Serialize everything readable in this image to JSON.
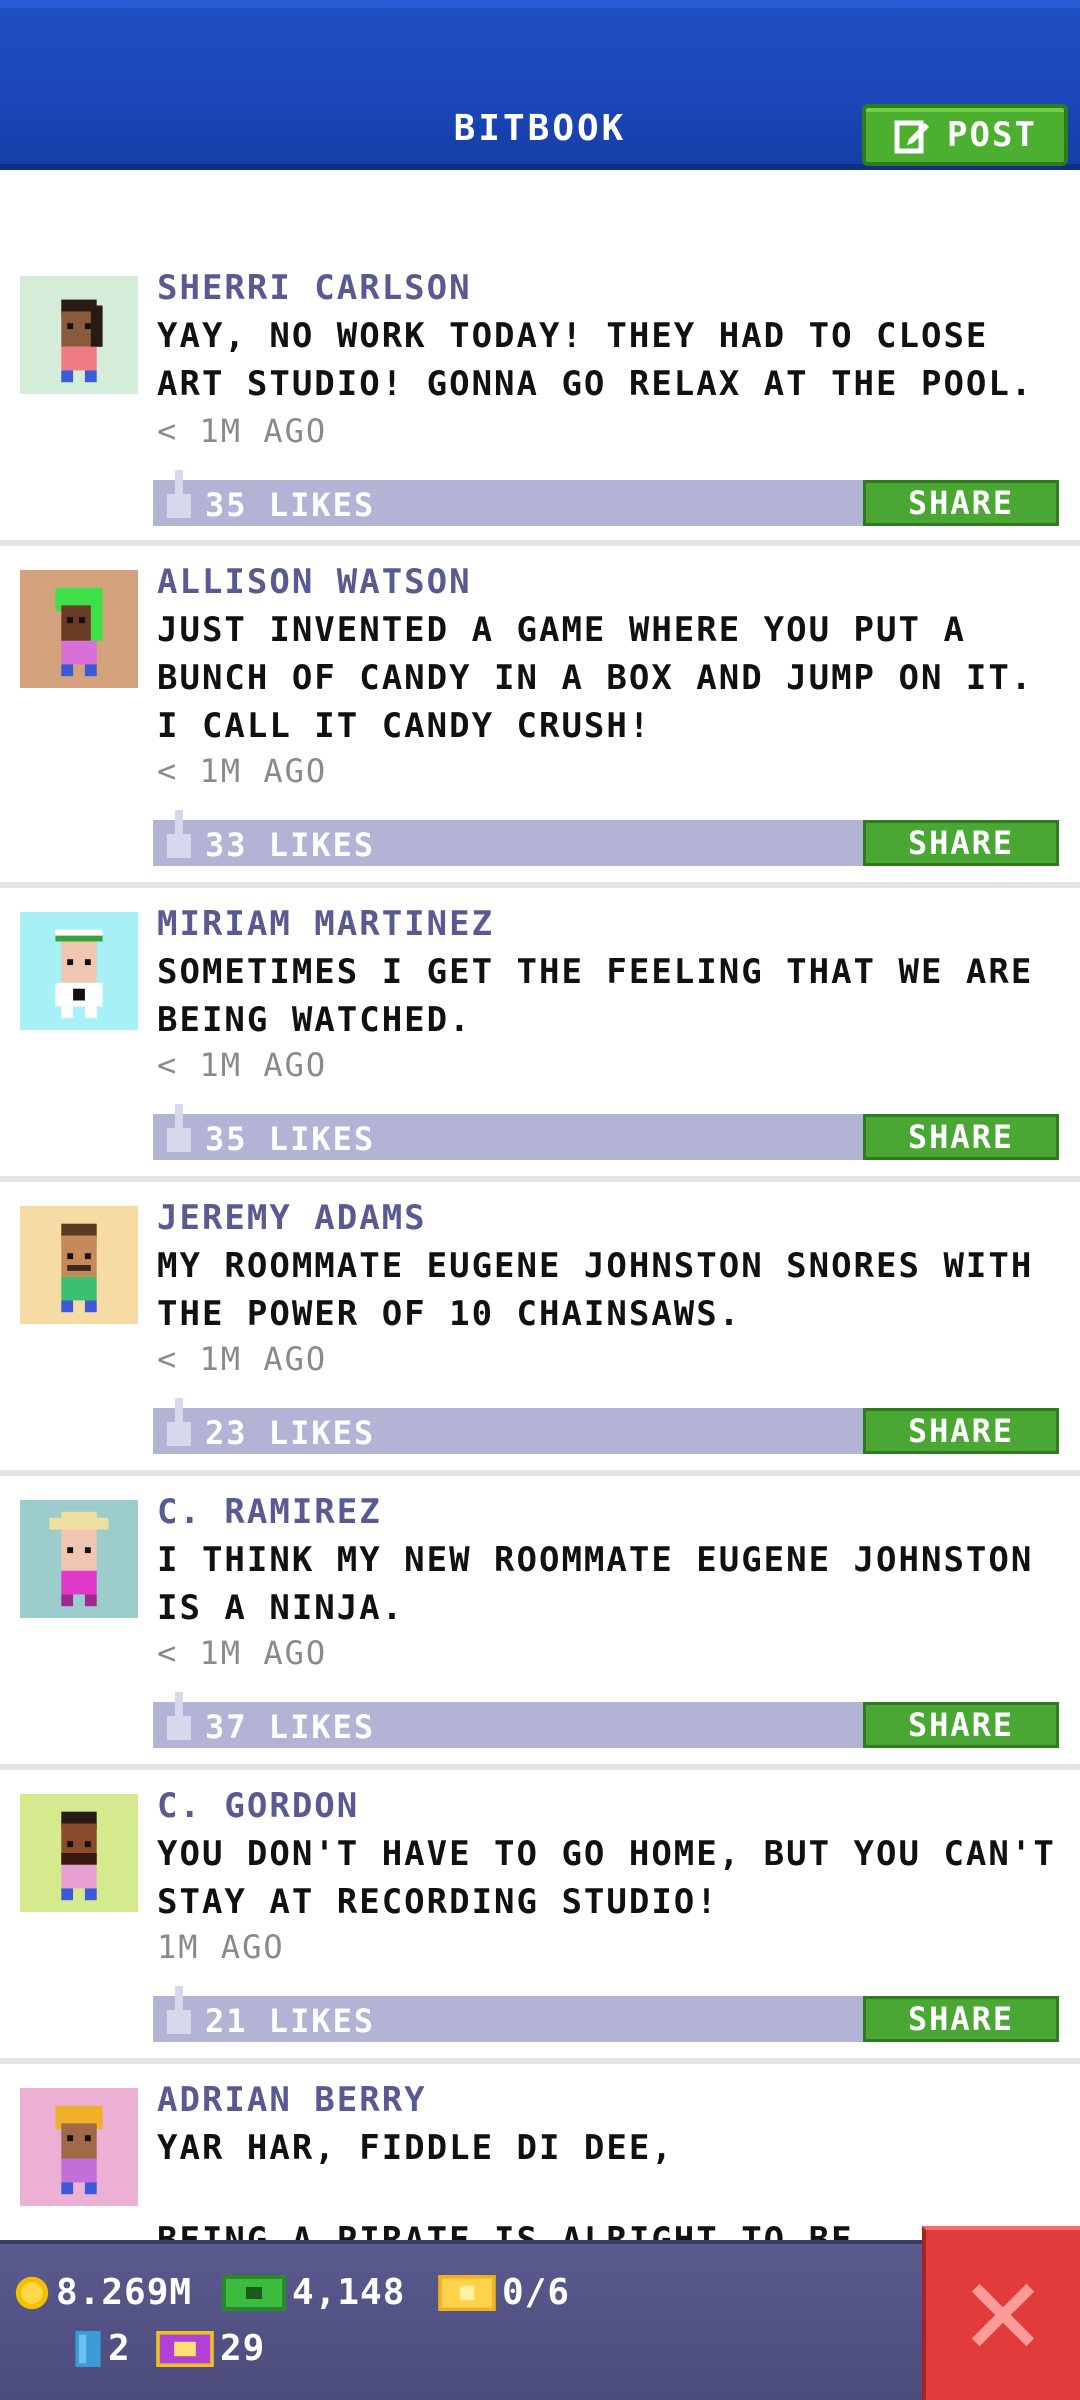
{
  "header": {
    "title": "BITBOOK",
    "post_label": "POST"
  },
  "posts": [
    {
      "name": "SHERRI CARLSON",
      "text": "YAY, NO WORK TODAY! THEY HAD TO CLOSE ART STUDIO! GONNA GO RELAX AT THE POOL.",
      "time": "< 1M AGO",
      "likes": "35 LIKES",
      "share": "SHARE",
      "avatar_bg": "#d4ecd8"
    },
    {
      "name": "ALLISON WATSON",
      "text": "JUST INVENTED A GAME WHERE YOU PUT A BUNCH OF CANDY IN A BOX AND JUMP ON IT. I CALL IT CANDY CRUSH!",
      "time": "< 1M AGO",
      "likes": "33 LIKES",
      "share": "SHARE",
      "avatar_bg": "#d4a27c"
    },
    {
      "name": "MIRIAM MARTINEZ",
      "text": "SOMETIMES I GET THE FEELING THAT WE ARE BEING WATCHED.",
      "time": "< 1M AGO",
      "likes": "35 LIKES",
      "share": "SHARE",
      "avatar_bg": "#a6f0f6"
    },
    {
      "name": "JEREMY ADAMS",
      "text": "MY ROOMMATE EUGENE JOHNSTON SNORES WITH THE POWER OF 10 CHAINSAWS.",
      "time": "< 1M AGO",
      "likes": "23 LIKES",
      "share": "SHARE",
      "avatar_bg": "#f6dca4"
    },
    {
      "name": "C. RAMIREZ",
      "text": "I THINK MY NEW ROOMMATE EUGENE JOHNSTON IS A NINJA.",
      "time": "< 1M AGO",
      "likes": "37 LIKES",
      "share": "SHARE",
      "avatar_bg": "#9ccccc"
    },
    {
      "name": "C. GORDON",
      "text": "YOU DON'T HAVE TO GO HOME, BUT YOU CAN'T STAY AT RECORDING STUDIO!",
      "time": "1M AGO",
      "likes": "21 LIKES",
      "share": "SHARE",
      "avatar_bg": "#d4ea8c"
    },
    {
      "name": "ADRIAN BERRY",
      "text": "YAR HAR, FIDDLE DI DEE,",
      "text2": "BEING A PIRATE IS ALRIGHT TO BE",
      "avatar_bg": "#ecb0d4"
    }
  ],
  "bottom": {
    "coins": "8.269M",
    "bux": "4,148",
    "tickets": "0/6",
    "keys": "2",
    "vip": "29"
  }
}
